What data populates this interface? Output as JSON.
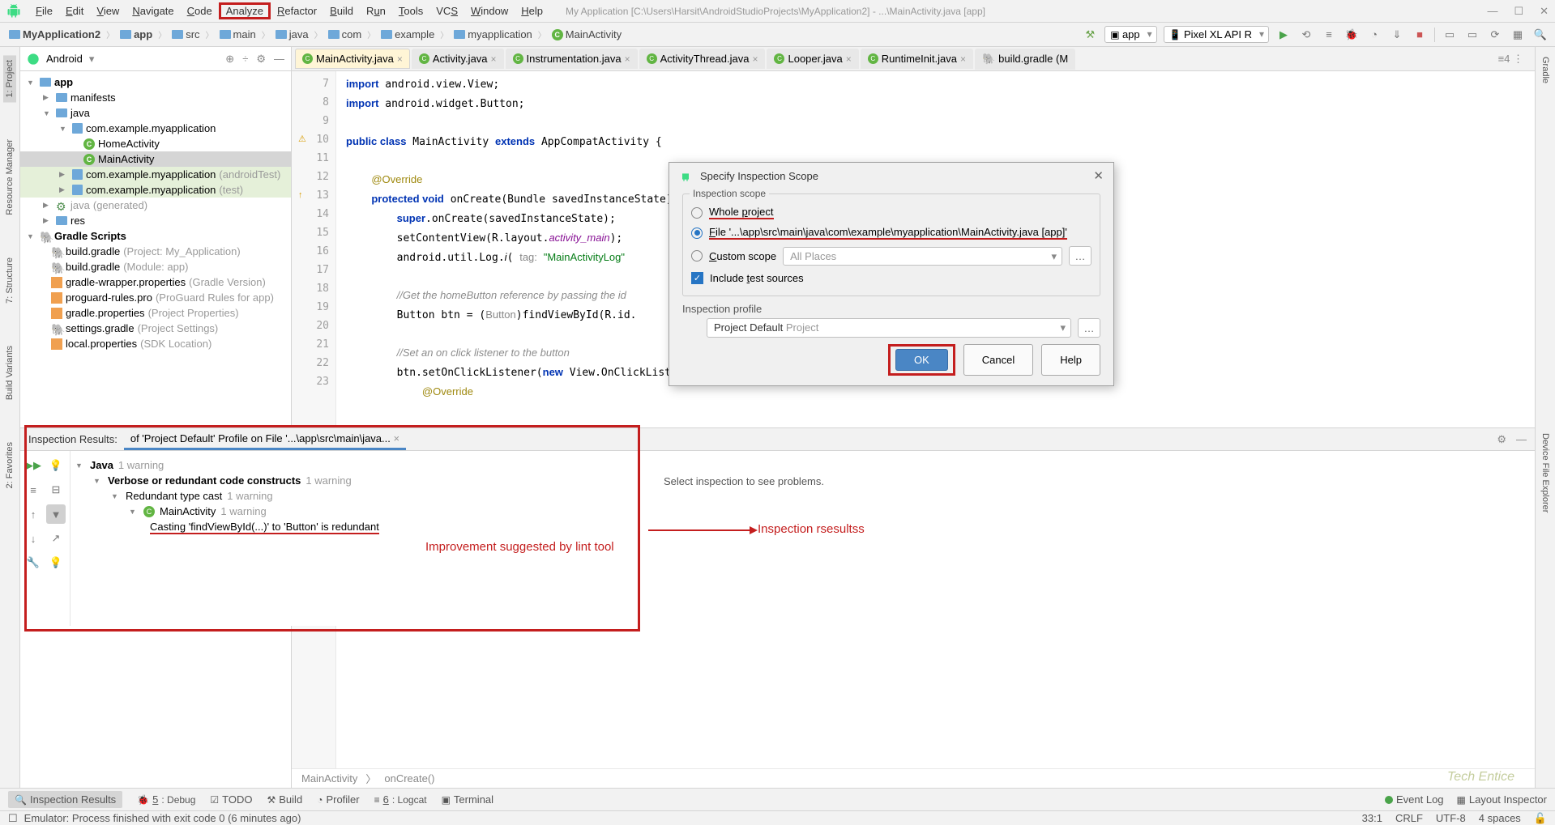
{
  "window": {
    "title": "My Application [C:\\Users\\Harsit\\AndroidStudioProjects\\MyApplication2] - ...\\MainActivity.java [app]"
  },
  "menu": {
    "file": "File",
    "edit": "Edit",
    "view": "View",
    "navigate": "Navigate",
    "code": "Code",
    "analyze": "Analyze",
    "refactor": "Refactor",
    "build": "Build",
    "run": "Run",
    "tools": "Tools",
    "vcs": "VCS",
    "window": "Window",
    "help": "Help"
  },
  "breadcrumb": [
    "MyApplication2",
    "app",
    "src",
    "main",
    "java",
    "com",
    "example",
    "myapplication",
    "MainActivity"
  ],
  "run_config": "app",
  "device": "Pixel XL API R",
  "project_view": "Android",
  "tree": {
    "app": "app",
    "manifests": "manifests",
    "javaf": "java",
    "pkg_main": "com.example.myapplication",
    "home": "HomeActivity",
    "main": "MainActivity",
    "pkg_atest": "com.example.myapplication",
    "pkg_atest_suf": " (androidTest)",
    "pkg_test": "com.example.myapplication",
    "pkg_test_suf": " (test)",
    "gen": "java",
    "gen_suf": " (generated)",
    "res": "res",
    "gradle_scripts": "Gradle Scripts",
    "bg1": "build.gradle",
    "bg1s": " (Project: My_Application)",
    "bg2": "build.gradle",
    "bg2s": " (Module: app)",
    "gw": "gradle-wrapper.properties",
    "gws": " (Gradle Version)",
    "pr": "proguard-rules.pro",
    "prs": " (ProGuard Rules for app)",
    "gp": "gradle.properties",
    "gps": " (Project Properties)",
    "sg": "settings.gradle",
    "sgs": " (Project Settings)",
    "lp": "local.properties",
    "lps": " (SDK Location)"
  },
  "tabs": [
    {
      "label": "MainActivity.java",
      "active": true
    },
    {
      "label": "Activity.java"
    },
    {
      "label": "Instrumentation.java"
    },
    {
      "label": "ActivityThread.java"
    },
    {
      "label": "Looper.java"
    },
    {
      "label": "RuntimeInit.java"
    },
    {
      "label": "build.gradle (M"
    }
  ],
  "code": {
    "l7": "import android.view.View;",
    "l8": "import android.widget.Button;",
    "l10a": "public class",
    "l10b": " MainActivity ",
    "l10c": "extends",
    "l10d": " AppCompatActivity {",
    "l12": "@Override",
    "l13a": "protected void",
    "l13b": " onCreate(Bundle savedInstanceState) {",
    "l14a": "super",
    "l14b": ".onCreate(savedInstanceState);",
    "l15a": "setContentView(R.layout.",
    "l15b": "activity_main",
    "l15c": ");",
    "l16a": "android.util.Log.",
    "l16b": "i",
    "l16c": "( tag: ",
    "l16d": "\"MainActivityLog\"",
    "l18": "//Get the homeButton reference by passing the id",
    "l19a": "Button btn = (",
    "l19b": "Button",
    "l19c": ")findViewById(R.id.",
    "l21": "//Set an on click listener to the button",
    "l22a": "btn.setOnClickListener(",
    "l22b": "new",
    "l22c": " View.OnClickListener",
    "l23": "@Override"
  },
  "breadcrumb2": {
    "a": "MainActivity",
    "b": "onCreate()"
  },
  "dialog": {
    "title": "Specify Inspection Scope",
    "scope_label": "Inspection scope",
    "whole": "Whole project",
    "file": "File '...\\app\\src\\main\\java\\com\\example\\myapplication\\MainActivity.java [app]'",
    "custom": "Custom scope",
    "all_places": "All Places",
    "include": "Include test sources",
    "profile_label": "Inspection profile",
    "profile_name": "Project Default",
    "profile_suf": "  Project",
    "ok": "OK",
    "cancel": "Cancel",
    "help": "Help"
  },
  "inspection": {
    "header": "Inspection Results:",
    "tab": "of 'Project Default' Profile on File '...\\app\\src\\main\\java...",
    "java": "Java",
    "java_cnt": "1 warning",
    "verbose": "Verbose or redundant code constructs",
    "verbose_cnt": "1 warning",
    "redundant": "Redundant type cast",
    "redundant_cnt": "1 warning",
    "mainact": "MainActivity",
    "mainact_cnt": "1 warning",
    "cast": "Casting 'findViewById(...)' to 'Button' is redundant",
    "right_msg": "Select inspection to see problems."
  },
  "annotations": {
    "improve": "Improvement suggested by lint tool",
    "results": "Inspection rsesultss"
  },
  "bottombar": {
    "insp": "Inspection Results",
    "debug": "5: Debug",
    "todo": "TODO",
    "build": "Build",
    "profiler": "Profiler",
    "logcat": "6: Logcat",
    "terminal": "Terminal",
    "event": "Event Log",
    "layout": "Layout Inspector"
  },
  "statusbar": {
    "msg": "Emulator: Process finished with exit code 0 (6 minutes ago)",
    "pos": "33:1",
    "le": "CRLF",
    "enc": "UTF-8",
    "indent": "4 spaces"
  },
  "sidetabs": {
    "project": "1: Project",
    "rm": "Resource Manager",
    "struct": "7: Structure",
    "bv": "Build Variants",
    "fav": "2: Favorites",
    "gradle": "Gradle",
    "dfe": "Device File Explorer"
  },
  "watermark": "Tech Entice"
}
